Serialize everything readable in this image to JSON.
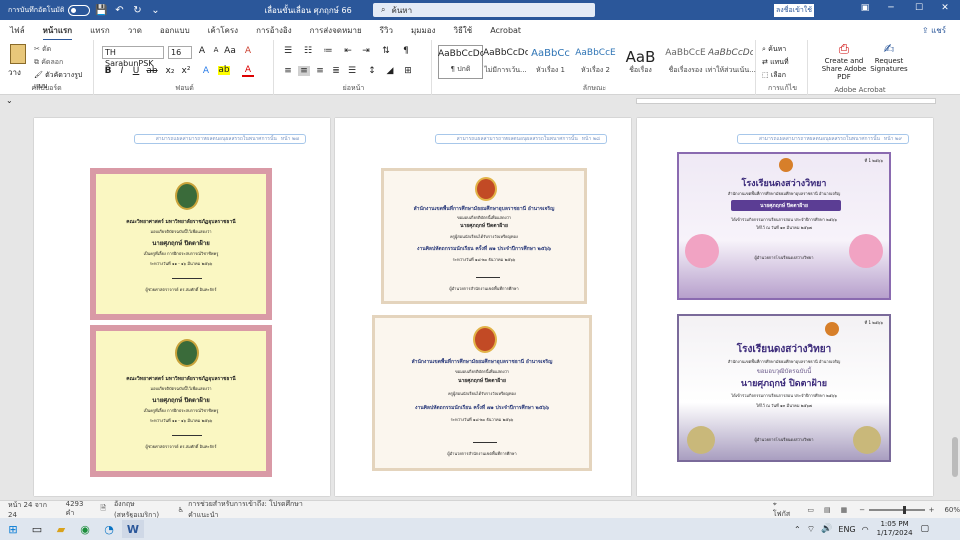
{
  "app": {
    "autosave": "การบันทึกอัตโนมัติ",
    "doc_title": "เลื่อนขั้นเลื่อน ศุภฤกษ์ 66",
    "search_placeholder": "ค้นหา",
    "signin": "ลงชื่อเข้าใช้",
    "share": "แชร์"
  },
  "tabs": [
    "ไฟล์",
    "หน้าแรก",
    "แทรก",
    "วาด",
    "ออกแบบ",
    "เค้าโครง",
    "การอ้างอิง",
    "การส่งจดหมาย",
    "รีวิว",
    "มุมมอง",
    "วิธีใช้",
    "Acrobat"
  ],
  "ribbon": {
    "clipboard": {
      "paste": "วาง",
      "cut": "ตัด",
      "copy": "คัดลอก",
      "format_painter": "ตัวคัดวางรูปแบบ",
      "label": "คลิปบอร์ด"
    },
    "font": {
      "name": "TH SarabunPSK",
      "size": "16",
      "label": "ฟอนต์"
    },
    "paragraph": {
      "label": "ย่อหน้า"
    },
    "styles": {
      "items": [
        {
          "preview": "AaBbCcDc",
          "name": "¶ ปกติ"
        },
        {
          "preview": "AaBbCcDc",
          "name": "ไม่มีการเว้น..."
        },
        {
          "preview": "AaBbCc",
          "name": "หัวเรื่อง 1"
        },
        {
          "preview": "AaBbCcE",
          "name": "หัวเรื่อง 2"
        },
        {
          "preview": "AaB",
          "name": "ชื่อเรื่อง"
        },
        {
          "preview": "AaBbCcE",
          "name": "ชื่อเรื่องรอง"
        },
        {
          "preview": "AaBbCcDc",
          "name": "เท่าให้ส่วนเน้น..."
        }
      ],
      "label": "ลักษณะ"
    },
    "editing": {
      "find": "ค้นหา",
      "replace": "แทนที่",
      "select": "เลือก",
      "label": "การแก้ไข"
    },
    "acrobat": {
      "create_share": "Create and Share Adobe PDF",
      "request": "Request Signatures",
      "label": "Adobe Acrobat"
    }
  },
  "pages": [
    {
      "header": "สามารถแผลสามารถาหผลตนอนุผลสรรถในพนาศการนั้น",
      "page_no": "หน้า ๒๗"
    },
    {
      "header": "สามารถแผลสามารถาหผลตนอนุผลสรรถในพนาศการนั้น",
      "page_no": "หน้า ๒๘"
    },
    {
      "header": "สามารถแผลสามารถาหผลตนอนุผลสรรถในพนาศการนั้น",
      "page_no": "หน้า ๒๙"
    }
  ],
  "certs": {
    "yellow": {
      "org": "คณะวิทยาศาสตร์ มหาวิทยาลัยราชภัฏอุบลราชธานี",
      "line1": "มอบเกียรติบัตรฉบับนี้ไว้เพื่อแสดงว่า",
      "name": "นายศุภฤกษ์ ปิดตาฝ้าย",
      "line2": "เป็นครูพี่เลี้ยง การฝึกประสบการณ์วิชาชีพครู",
      "line3": "ระหว่างวันที่ ๑๑ - ๑๖ มีนาคม ๒๕๖๖",
      "sign": "ผู้ช่วยศาสตราจารย์ ดร.สมศักดิ์ อินทะจักร์"
    },
    "white": {
      "org": "สำนักงานเขตพื้นที่การศึกษามัธยมศึกษาอุบลราชธานี อำนาจเจริญ",
      "line1": "ขอมอบเกียรติบัตรนี้เพื่อแสดงว่า",
      "name": "นายศุภฤกษ์ ปิดตาฝ้าย",
      "line2": "ครูผู้สอนนักเรียนได้รับรางวัลเหรียญทอง",
      "event": "งานศิลปหัตถกรรมนักเรียน ครั้งที่ ๗๑ ประจำปีการศึกษา ๒๕๖๖",
      "line3": "ระหว่างวันที่ ๑๘-๒๐ ธันวาคม ๒๕๖๖",
      "sign": "ผู้อำนวยการสำนักงานเขตพื้นที่การศึกษา"
    },
    "school": {
      "badge": "ที่ 1 ๒๕๖๖",
      "school": "โรงเรียนดงสว่างวิทยา",
      "org": "สำนักงานเขตพื้นที่การศึกษามัธยมศึกษาอุบลราชธานี อำนาจเจริญ",
      "cert_title": "ขอมอบวุฒิบัตรฉบับนี้",
      "name": "นายศุภฤกษ์ ปิดตาฝ้าย",
      "line1": "ได้เข้าร่วมกิจกรรมการเรียนการสอน ประจำปีการศึกษา ๒๕๖๖",
      "date": "ให้ไว้ ณ วันที่ ๑๓ มีนาคม ๒๕๖๗",
      "sign": "ผู้อำนวยการโรงเรียนดงสว่างวิทยา"
    }
  },
  "status": {
    "page": "หน้า 24 จาก 24",
    "words": "4293 คำ",
    "lang": "อังกฤษ (สหรัฐอเมริกา)",
    "access": "การช่วยสำหรับการเข้าถึง: โปรดศึกษาคำแนะนำ",
    "focus": "โฟกัส",
    "zoom": "60%"
  },
  "taskbar": {
    "lang": "ENG",
    "time": "1:05 PM",
    "date": "1/17/2024"
  }
}
